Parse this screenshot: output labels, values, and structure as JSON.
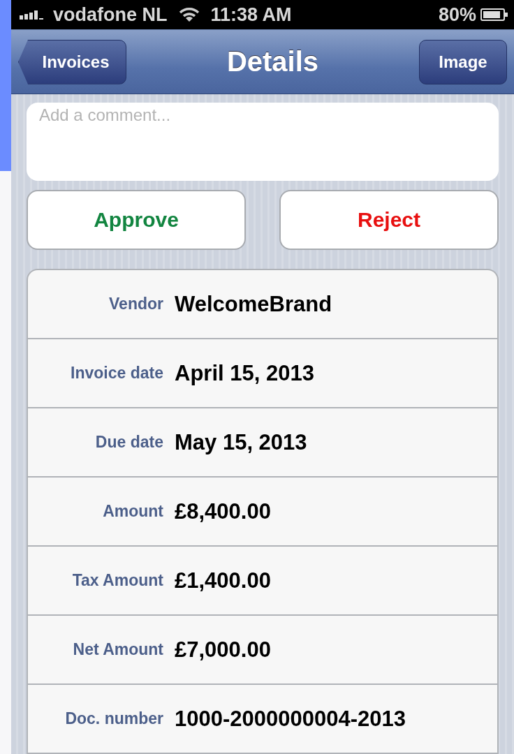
{
  "status_bar": {
    "carrier": "vodafone NL",
    "time": "11:38 AM",
    "battery": "80%"
  },
  "nav_bar": {
    "back_button": "Invoices",
    "title": "Details",
    "right_button": "Image"
  },
  "comment": {
    "placeholder": "Add a comment..."
  },
  "actions": [
    {
      "label": "Approve",
      "kind": "approve"
    },
    {
      "label": "Reject",
      "kind": "reject"
    }
  ],
  "details": [
    {
      "label": "Vendor",
      "value": "WelcomeBrand"
    },
    {
      "label": "Invoice date",
      "value": "April 15, 2013"
    },
    {
      "label": "Due date",
      "value": "May 15, 2013"
    },
    {
      "label": "Amount",
      "value": "£8,400.00"
    },
    {
      "label": "Tax Amount",
      "value": "£1,400.00"
    },
    {
      "label": "Net Amount",
      "value": "£7,000.00"
    },
    {
      "label": "Doc. number",
      "value": "1000-2000000004-2013"
    }
  ]
}
